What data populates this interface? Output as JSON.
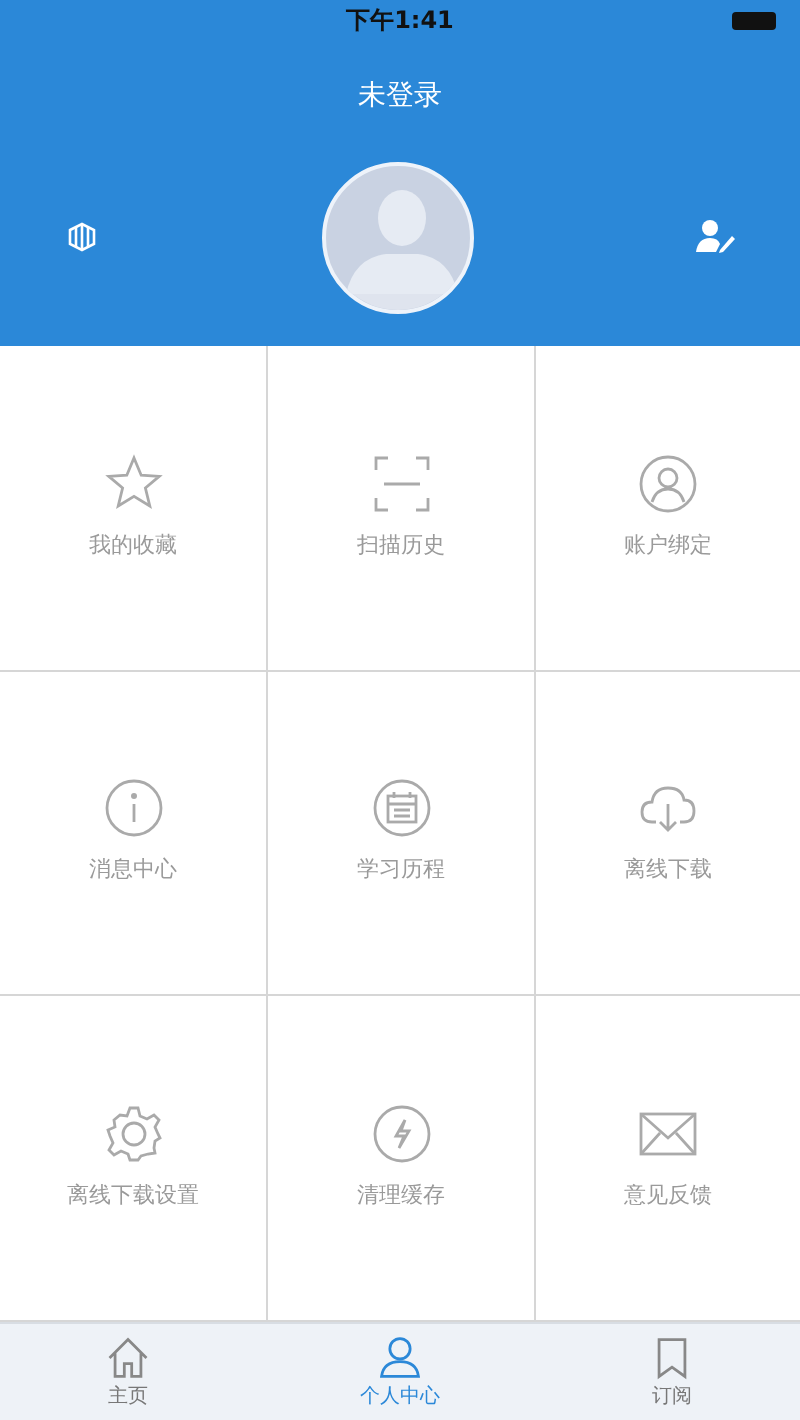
{
  "status_bar": {
    "time": "下午1:41"
  },
  "header": {
    "title": "未登录"
  },
  "grid": [
    {
      "label": "我的收藏"
    },
    {
      "label": "扫描历史"
    },
    {
      "label": "账户绑定"
    },
    {
      "label": "消息中心"
    },
    {
      "label": "学习历程"
    },
    {
      "label": "离线下载"
    },
    {
      "label": "离线下载设置"
    },
    {
      "label": "清理缓存"
    },
    {
      "label": "意见反馈"
    }
  ],
  "tabs": [
    {
      "label": "主页",
      "selected": false
    },
    {
      "label": "个人中心",
      "selected": true
    },
    {
      "label": "订阅",
      "selected": false
    }
  ]
}
